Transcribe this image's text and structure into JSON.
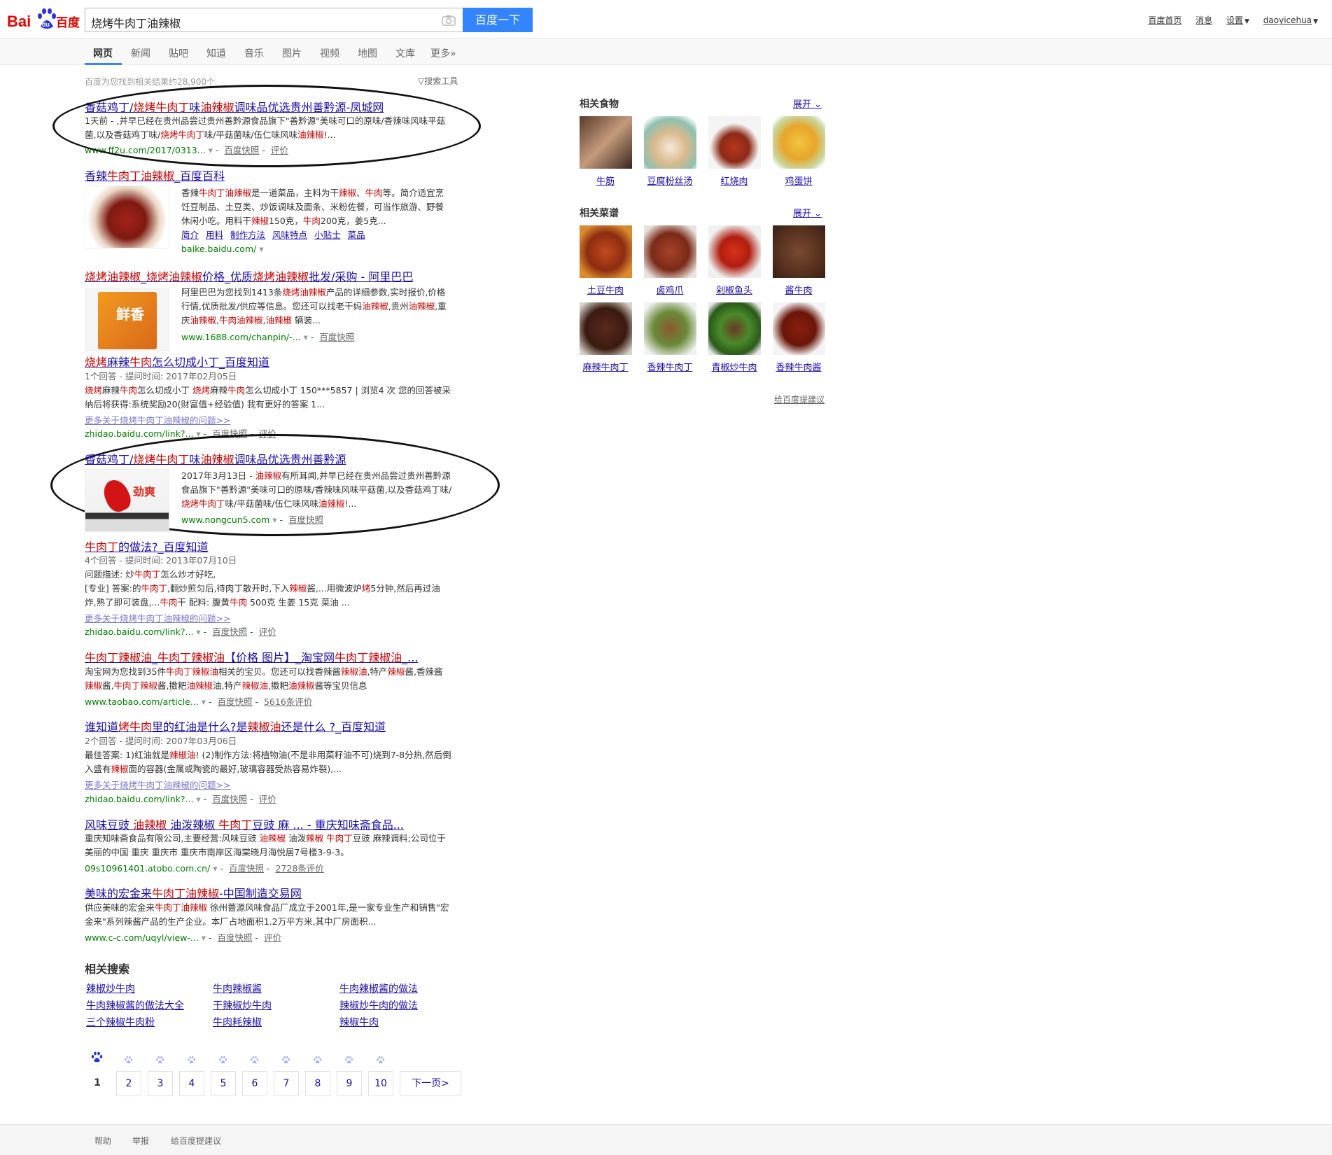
{
  "header": {
    "logo_text_a": "Bai",
    "logo_text_b": "du",
    "logo_text_c": "百度",
    "query": "烧烤牛肉丁油辣椒",
    "search_button": "百度一下",
    "links": [
      "百度首页",
      "消息",
      "设置",
      "daoyicehua"
    ]
  },
  "nav": {
    "tabs": [
      "网页",
      "新闻",
      "贴吧",
      "知道",
      "音乐",
      "图片",
      "视频",
      "地图",
      "文库",
      "更多»"
    ]
  },
  "stats": {
    "result_count": "百度为您找到相关结果约28,900个",
    "tools": "搜索工具"
  },
  "results": [
    {
      "title_parts": [
        "香菇鸡丁/",
        "烧烤牛肉丁",
        "味",
        "油辣椒",
        "调味品优选贵州善黔源-凤城网"
      ],
      "lines": [
        "1天前 - ,并早已经在贵州品尝过贵州善黔源食品旗下\"善黔源\"美味可口的原味/香辣味风味平菇",
        "菌,以及香菇鸡丁味/烧烤牛肉丁味/平菇菌味/伍仁味风味油辣椒!..."
      ],
      "url": "www.ff2u.com/2017/0313...",
      "links": [
        "百度快照",
        "评价"
      ]
    },
    {
      "title_parts": [
        "香辣",
        "牛肉丁油辣椒",
        "_百度百科"
      ],
      "lines": [
        "香辣牛肉丁油辣椒是一道菜品，主料为干辣椒、牛肉等。简介适宜烹",
        "饪豆制品、土豆类、炒饭调味及面条、米粉佐餐，可当作旅游、野餐",
        "休闲小吃。用料干辣椒150克，牛肉200克，姜5克..."
      ],
      "sublinks": [
        "简介",
        "用料",
        "制作方法",
        "风味特点",
        "小贴士",
        "菜品"
      ],
      "url": "baike.baidu.com/"
    },
    {
      "title_parts": [
        "烧烤油辣椒",
        "_",
        "烧烤油辣椒",
        "价格_优质",
        "烧烤油辣椒",
        "批发/采购 - 阿里巴巴"
      ],
      "lines": [
        "阿里巴巴为您找到1413条烧烤油辣椒产品的详细参数,实时报价,价格",
        "行情,优质批发/供应等信息。您还可以找老干妈油辣椒,贵州油辣椒,重",
        "庆油辣椒,牛肉油辣椒,油辣椒 辆装..."
      ],
      "thumb_text": "鲜香",
      "url": "www.1688.com/chanpin/-...",
      "links": [
        "百度快照"
      ]
    },
    {
      "title_parts": [
        "烧烤",
        "麻辣",
        "牛肉",
        "怎么切成小丁_百度知道"
      ],
      "meta": "1个回答 - 提问时间: 2017年02月05日",
      "lines": [
        "烧烤麻辣牛肉怎么切成小丁 烧烤麻辣牛肉怎么切成小丁 150***5857 | 浏览4 次 您的回答被采",
        "纳后将获得:系统奖励20(财富值+经验值) 我有更好的答案 1..."
      ],
      "more": "更多关于烧烤牛肉丁油辣椒的问题>>",
      "url": "zhidao.baidu.com/link?...",
      "links": [
        "百度快照",
        "评价"
      ]
    },
    {
      "title_parts": [
        "香菇鸡丁/",
        "烧烤牛肉丁",
        "味",
        "油辣椒",
        "调味品优选贵州善黔源"
      ],
      "lines": [
        "2017年3月13日 - 油辣椒有所耳闻,并早已经在贵州品尝过贵州善黔源",
        "食品旗下\"善黔源\"美味可口的原味/香辣味风味平菇菌,以及香菇鸡丁味/",
        "烧烤牛肉丁味/平菇菌味/伍仁味风味油辣椒!..."
      ],
      "thumb_text": "劲爽",
      "url": "www.nongcun5.com",
      "links": [
        "百度快照"
      ]
    },
    {
      "title_parts": [
        "牛肉丁",
        "的做法?_百度知道"
      ],
      "meta": "4个回答 - 提问时间: 2013年07月10日",
      "lines": [
        "问题描述: 炒牛肉丁怎么炒才好吃,",
        "[专业] 答案:的牛肉丁,翻炒煎匀后,待肉丁散开时,下入辣椒酱,...用微波炉烤5分钟,然后再过油",
        "炸,熟了即可装盘,...牛肉干 配料: 腹黄牛肉 500克 生姜 15克 菜油 ..."
      ],
      "more": "更多关于烧烤牛肉丁油辣椒的问题>>",
      "url": "zhidao.baidu.com/link?...",
      "links": [
        "百度快照",
        "评价"
      ]
    },
    {
      "title_parts": [
        "牛肉丁辣椒油",
        "_",
        "牛肉丁辣椒油",
        "【价格 图片】_淘宝网",
        "牛肉丁辣椒油",
        "_..."
      ],
      "lines": [
        "淘宝网为您找到35件牛肉丁辣椒油相关的宝贝。您还可以找香辣酱辣椒油,特产辣椒酱,香辣酱",
        "辣椒酱,牛肉丁辣椒酱,擞粑油辣椒油,特产辣椒油,擞粑油辣椒酱等宝贝信息"
      ],
      "url": "www.taobao.com/article...",
      "links": [
        "百度快照",
        "5616条评价"
      ]
    },
    {
      "title_parts": [
        "谁知道",
        "烤牛肉",
        "里的红油是什么?是",
        "辣椒油",
        "还是什么 ?_百度知道"
      ],
      "meta": "2个回答 - 提问时间: 2007年03月06日",
      "lines": [
        "最佳答案: 1)红油就是辣椒油! (2)制作方法:将植物油(不是非用菜籽油不可)烧到7-8分热,然后倒",
        "入盛有辣椒面的容器(金属或陶瓷的最好,玻璃容器受热容易炸裂),..."
      ],
      "more": "更多关于烧烤牛肉丁油辣椒的问题>>",
      "url": "zhidao.baidu.com/link?...",
      "links": [
        "百度快照",
        "评价"
      ]
    },
    {
      "title_parts": [
        "风味豆豉 ",
        "油辣椒",
        " 油泼辣椒 ",
        "牛肉丁",
        "豆豉 麻 ... - 重庆知味斋食品..."
      ],
      "lines": [
        "重庆知味斋食品有限公司,主要经营:风味豆豉 油辣椒 油泼辣椒 牛肉丁豆豉 麻辣调料;公司位于",
        "美丽的中国 重庆 重庆市 重庆市南岸区海棠晓月海悦居7号楼3-9-3。"
      ],
      "url": "09s10961401.atobo.com.cn/",
      "links": [
        "百度快照",
        "2728条评价"
      ]
    },
    {
      "title_parts": [
        "美味的宏金来",
        "牛肉丁油辣椒",
        "-中国制造交易网"
      ],
      "lines": [
        "供应美味的宏金来牛肉丁油辣椒 徐州蔷源风味食品厂成立于2001年,是一家专业生产和销售\"宏",
        "金来\"系列辣酱产品的生产企业。本厂占地面积1.2万平方米,其中厂房面积..."
      ],
      "url": "www.c-c.com/uqyl/view-...",
      "links": [
        "百度快照",
        "评价"
      ]
    }
  ],
  "sidebar": {
    "food_title": "相关食物",
    "expand": "展开",
    "foods": [
      "牛筋",
      "豆腐粉丝汤",
      "红烧肉",
      "鸡蛋饼"
    ],
    "recipe_title": "相关菜谱",
    "recipes": [
      "土豆牛肉",
      "卤鸡爪",
      "剁椒鱼头",
      "酱牛肉",
      "麻辣牛肉丁",
      "香辣牛肉丁",
      "青椒炒牛肉",
      "香辣牛肉酱"
    ],
    "feedback": "给百度提建议"
  },
  "related": {
    "title": "相关搜索",
    "items": [
      "辣椒炒牛肉",
      "牛肉辣椒酱",
      "牛肉辣椒酱的做法",
      "牛肉辣椒酱的做法大全",
      "干辣椒炒牛肉",
      "辣椒炒牛肉的做法",
      "三个辣椒牛肉粉",
      "牛肉耗辣椒",
      "辣椒牛肉"
    ]
  },
  "pagination": {
    "pages": [
      "1",
      "2",
      "3",
      "4",
      "5",
      "6",
      "7",
      "8",
      "9",
      "10"
    ],
    "next": "下一页>"
  },
  "footer": {
    "links": [
      "帮助",
      "举报",
      "给百度提建议"
    ]
  },
  "colors": {
    "brand_blue": "#3385ff",
    "brand_red": "#e10602",
    "link": "#1a0dab",
    "highlight": "#cc0000",
    "url_green": "#008000"
  }
}
